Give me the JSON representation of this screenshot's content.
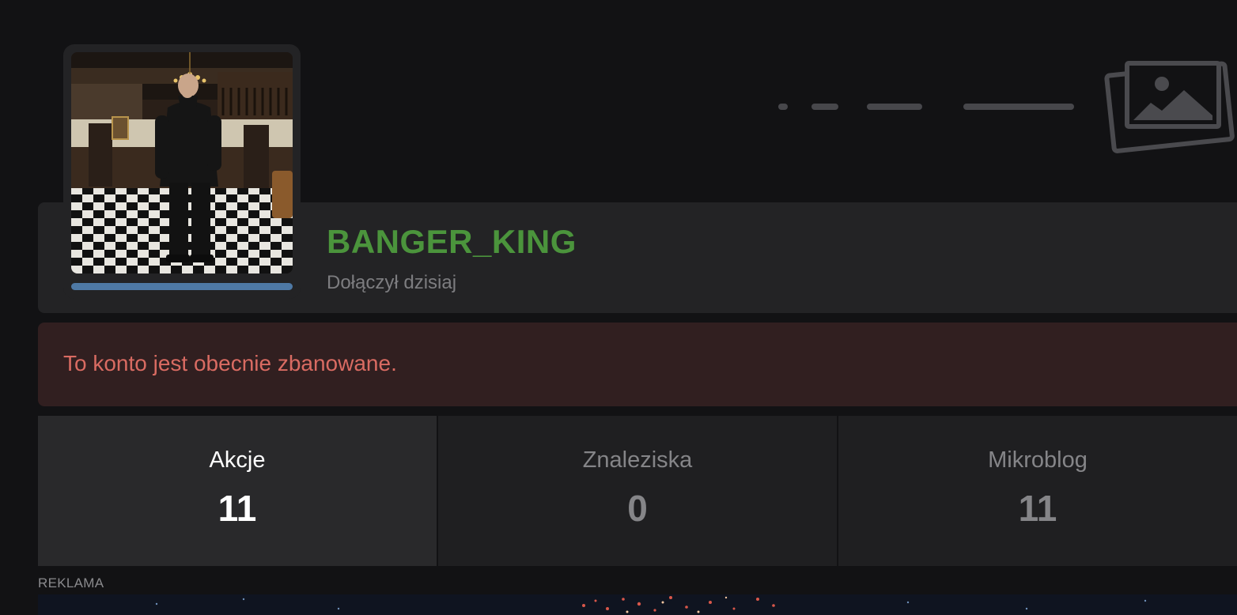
{
  "profile": {
    "username": "BANGER_KING",
    "joined": "Dołączył dzisiaj",
    "username_color": "#4b943c",
    "avatar_bar_color": "#4e79a5"
  },
  "notice": {
    "text": "To konto jest obecnie zbanowane.",
    "color": "#d96b62"
  },
  "stats": [
    {
      "label": "Akcje",
      "value": "11",
      "active": true
    },
    {
      "label": "Znaleziska",
      "value": "0",
      "active": false
    },
    {
      "label": "Mikroblog",
      "value": "11",
      "active": false
    }
  ],
  "ad": {
    "label": "REKLAMA"
  },
  "icons": {
    "cover": "image-placeholder-icon"
  }
}
